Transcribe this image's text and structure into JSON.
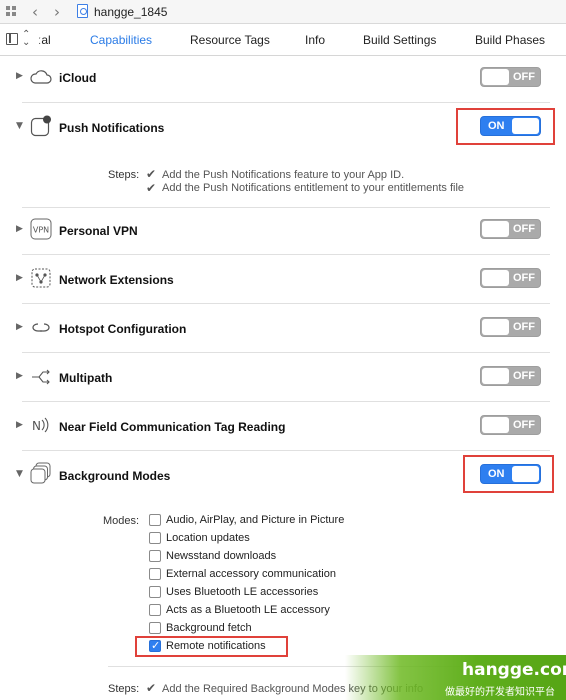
{
  "titlebar": {
    "file_name": "hangge_1845"
  },
  "tabs": [
    {
      "label": "ːal"
    },
    {
      "label": "Capabilities"
    },
    {
      "label": "Resource Tags"
    },
    {
      "label": "Info"
    },
    {
      "label": "Build Settings"
    },
    {
      "label": "Build Phases"
    }
  ],
  "capabilities": [
    {
      "label": "iCloud",
      "state": "OFF",
      "icon": "cloud-icon"
    },
    {
      "label": "Push Notifications",
      "state": "ON",
      "icon": "notification-icon"
    },
    {
      "label": "Personal VPN",
      "state": "OFF",
      "icon": "vpn-icon"
    },
    {
      "label": "Network Extensions",
      "state": "OFF",
      "icon": "network-extensions-icon"
    },
    {
      "label": "Hotspot Configuration",
      "state": "OFF",
      "icon": "hotspot-icon"
    },
    {
      "label": "Multipath",
      "state": "OFF",
      "icon": "multipath-icon"
    },
    {
      "label": "Near Field Communication Tag Reading",
      "state": "OFF",
      "icon": "nfc-icon"
    },
    {
      "label": "Background Modes",
      "state": "ON",
      "icon": "background-modes-icon"
    }
  ],
  "push_steps": {
    "label": "Steps:",
    "items": [
      "Add the Push Notifications feature to your App ID.",
      "Add the Push Notifications entitlement to your entitlements file"
    ]
  },
  "background_modes": {
    "label": "Modes:",
    "items": [
      {
        "label": "Audio, AirPlay, and Picture in Picture",
        "checked": false
      },
      {
        "label": "Location updates",
        "checked": false
      },
      {
        "label": "Newsstand downloads",
        "checked": false
      },
      {
        "label": "External accessory communication",
        "checked": false
      },
      {
        "label": "Uses Bluetooth LE accessories",
        "checked": false
      },
      {
        "label": "Acts as a Bluetooth LE accessory",
        "checked": false
      },
      {
        "label": "Background fetch",
        "checked": false
      },
      {
        "label": "Remote notifications",
        "checked": true
      }
    ]
  },
  "background_steps": {
    "label": "Steps:",
    "items": [
      "Add the Required Background Modes key to your info"
    ]
  },
  "watermark": {
    "title": "hangge.com",
    "subtitle": "做最好的开发者知识平台"
  },
  "colors": {
    "accent": "#2e7ff0",
    "highlight": "#e0413a",
    "toggle_off": "#aaaaaa"
  }
}
